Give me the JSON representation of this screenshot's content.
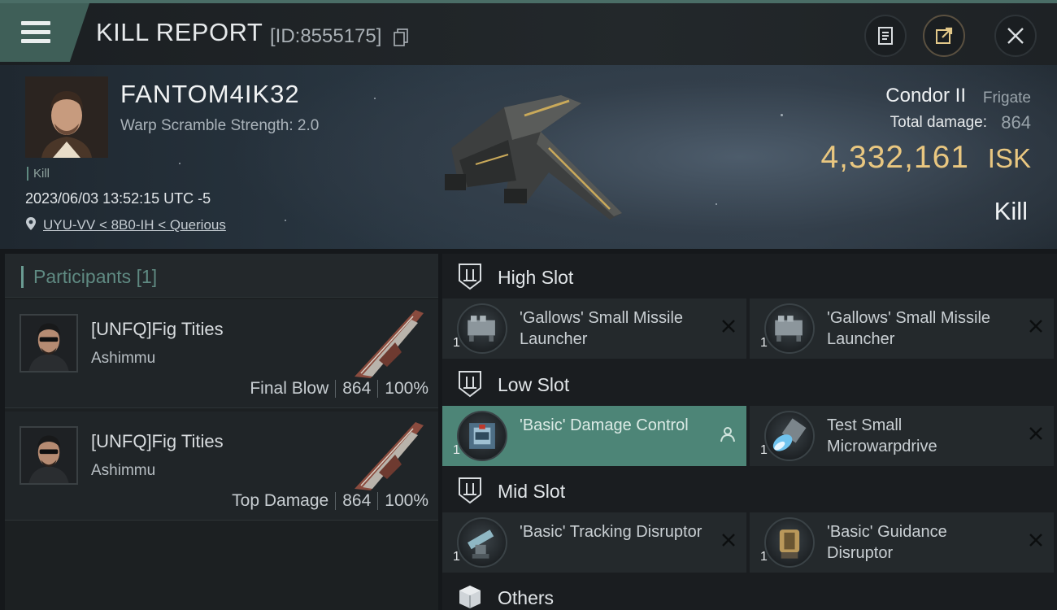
{
  "header": {
    "title": "KILL REPORT",
    "report_id": "[ID:8555175]"
  },
  "victim": {
    "pilot_name": "FANTOM4IK32",
    "warp_scramble": "Warp Scramble Strength: 2.0",
    "tag": "Kill",
    "datetime": "2023/06/03 13:52:15 UTC -5",
    "location": "UYU-VV < 8B0-IH < Querious",
    "ship_name": "Condor II",
    "ship_class": "Frigate",
    "total_damage_label": "Total damage:",
    "total_damage_value": "864",
    "isk_value": "4,332,161",
    "isk_unit": "ISK",
    "result": "Kill"
  },
  "participants": {
    "title": "Participants",
    "count": "[1]",
    "rows": [
      {
        "name": "[UNFQ]Fig Tities",
        "ship": "Ashimmu",
        "role": "Final Blow",
        "damage": "864",
        "percent": "100%"
      },
      {
        "name": "[UNFQ]Fig Tities",
        "ship": "Ashimmu",
        "role": "Top Damage",
        "damage": "864",
        "percent": "100%"
      }
    ]
  },
  "slots": {
    "high": {
      "label": "High Slot",
      "modules": [
        {
          "name": "'Gallows' Small Missile Launcher",
          "qty": "1"
        },
        {
          "name": "'Gallows' Small Missile Launcher",
          "qty": "1"
        }
      ]
    },
    "low": {
      "label": "Low Slot",
      "modules": [
        {
          "name": "'Basic' Damage Control",
          "qty": "1"
        },
        {
          "name": "Test Small Microwarpdrive",
          "qty": "1"
        }
      ]
    },
    "mid": {
      "label": "Mid Slot",
      "modules": [
        {
          "name": "'Basic' Tracking Disruptor",
          "qty": "1"
        },
        {
          "name": "'Basic' Guidance Disruptor",
          "qty": "1"
        }
      ]
    },
    "others": {
      "label": "Others"
    }
  },
  "colors": {
    "accent_teal": "#4d8577",
    "isk_gold": "#e9c780",
    "menu_tab": "#3f5f58"
  },
  "icons": [
    "menu-icon",
    "copy-icon",
    "clipboard-icon",
    "share-icon",
    "close-icon",
    "location-pin-icon",
    "close-x-icon",
    "user-icon",
    "slot-icon",
    "box-icon"
  ]
}
